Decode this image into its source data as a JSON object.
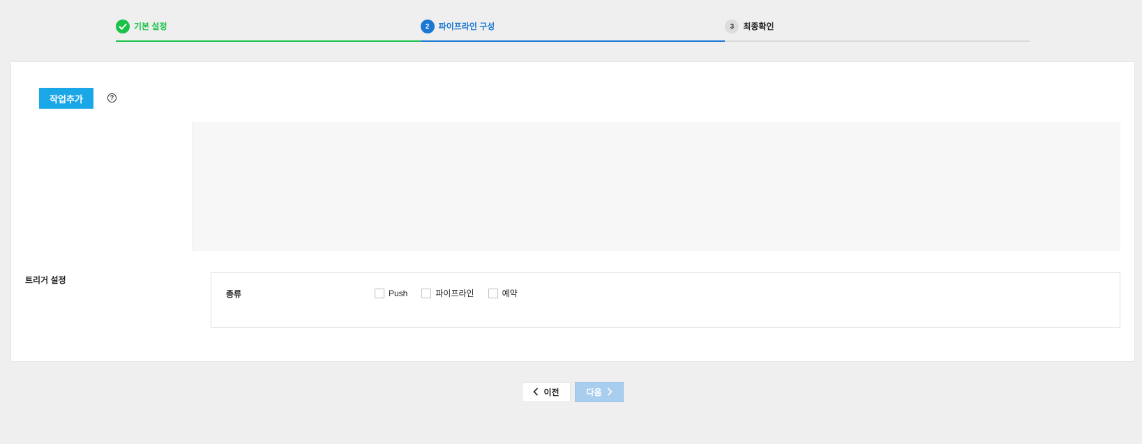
{
  "stepper": {
    "steps": [
      {
        "number": "",
        "label": "기본 설정",
        "state": "done"
      },
      {
        "number": "2",
        "label": "파이프라인 구성",
        "state": "active"
      },
      {
        "number": "3",
        "label": "최종확인",
        "state": "todo"
      }
    ]
  },
  "colors": {
    "done": "#1bc24a",
    "active": "#1b77d2",
    "primary_button": "#1aa7e8",
    "disabled_button": "#a9cdef"
  },
  "toolbar": {
    "add_job_label": "작업추가",
    "help_icon": "?"
  },
  "trigger": {
    "section_label": "트리거 설정",
    "kind_label": "종류",
    "options": [
      {
        "label": "Push",
        "checked": false
      },
      {
        "label": "파이프라인",
        "checked": false
      },
      {
        "label": "예약",
        "checked": false
      }
    ]
  },
  "nav": {
    "prev_label": "이전",
    "next_label": "다음"
  }
}
